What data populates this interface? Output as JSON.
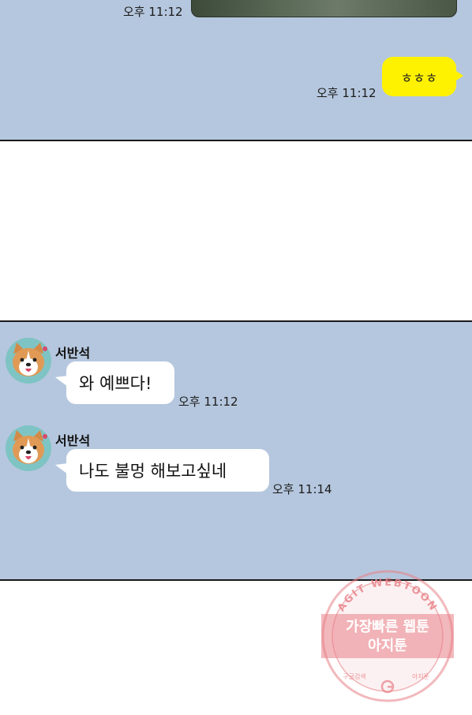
{
  "theme": {
    "chat_background": "#b5c7de",
    "my_bubble": "#fff200",
    "watermark_color": "#e87f86"
  },
  "panel_top": {
    "photo_time": "오후 11:12",
    "my_message": {
      "text": "ㅎㅎㅎ",
      "time": "오후 11:12"
    }
  },
  "panel_mid": {
    "messages": [
      {
        "sender": "서반석",
        "text": "와 예쁘다!",
        "time": "오후 11:12"
      },
      {
        "sender": "서반석",
        "text": "나도 불멍 해보고싶네",
        "time": "오후 11:14"
      }
    ]
  },
  "watermark": {
    "arc_text": "AGIT WEBTOON",
    "line1": "가장빠른 웹툰",
    "line2": "아지툰",
    "bottom_left": "구글검색",
    "bottom_right": "아지툰"
  }
}
